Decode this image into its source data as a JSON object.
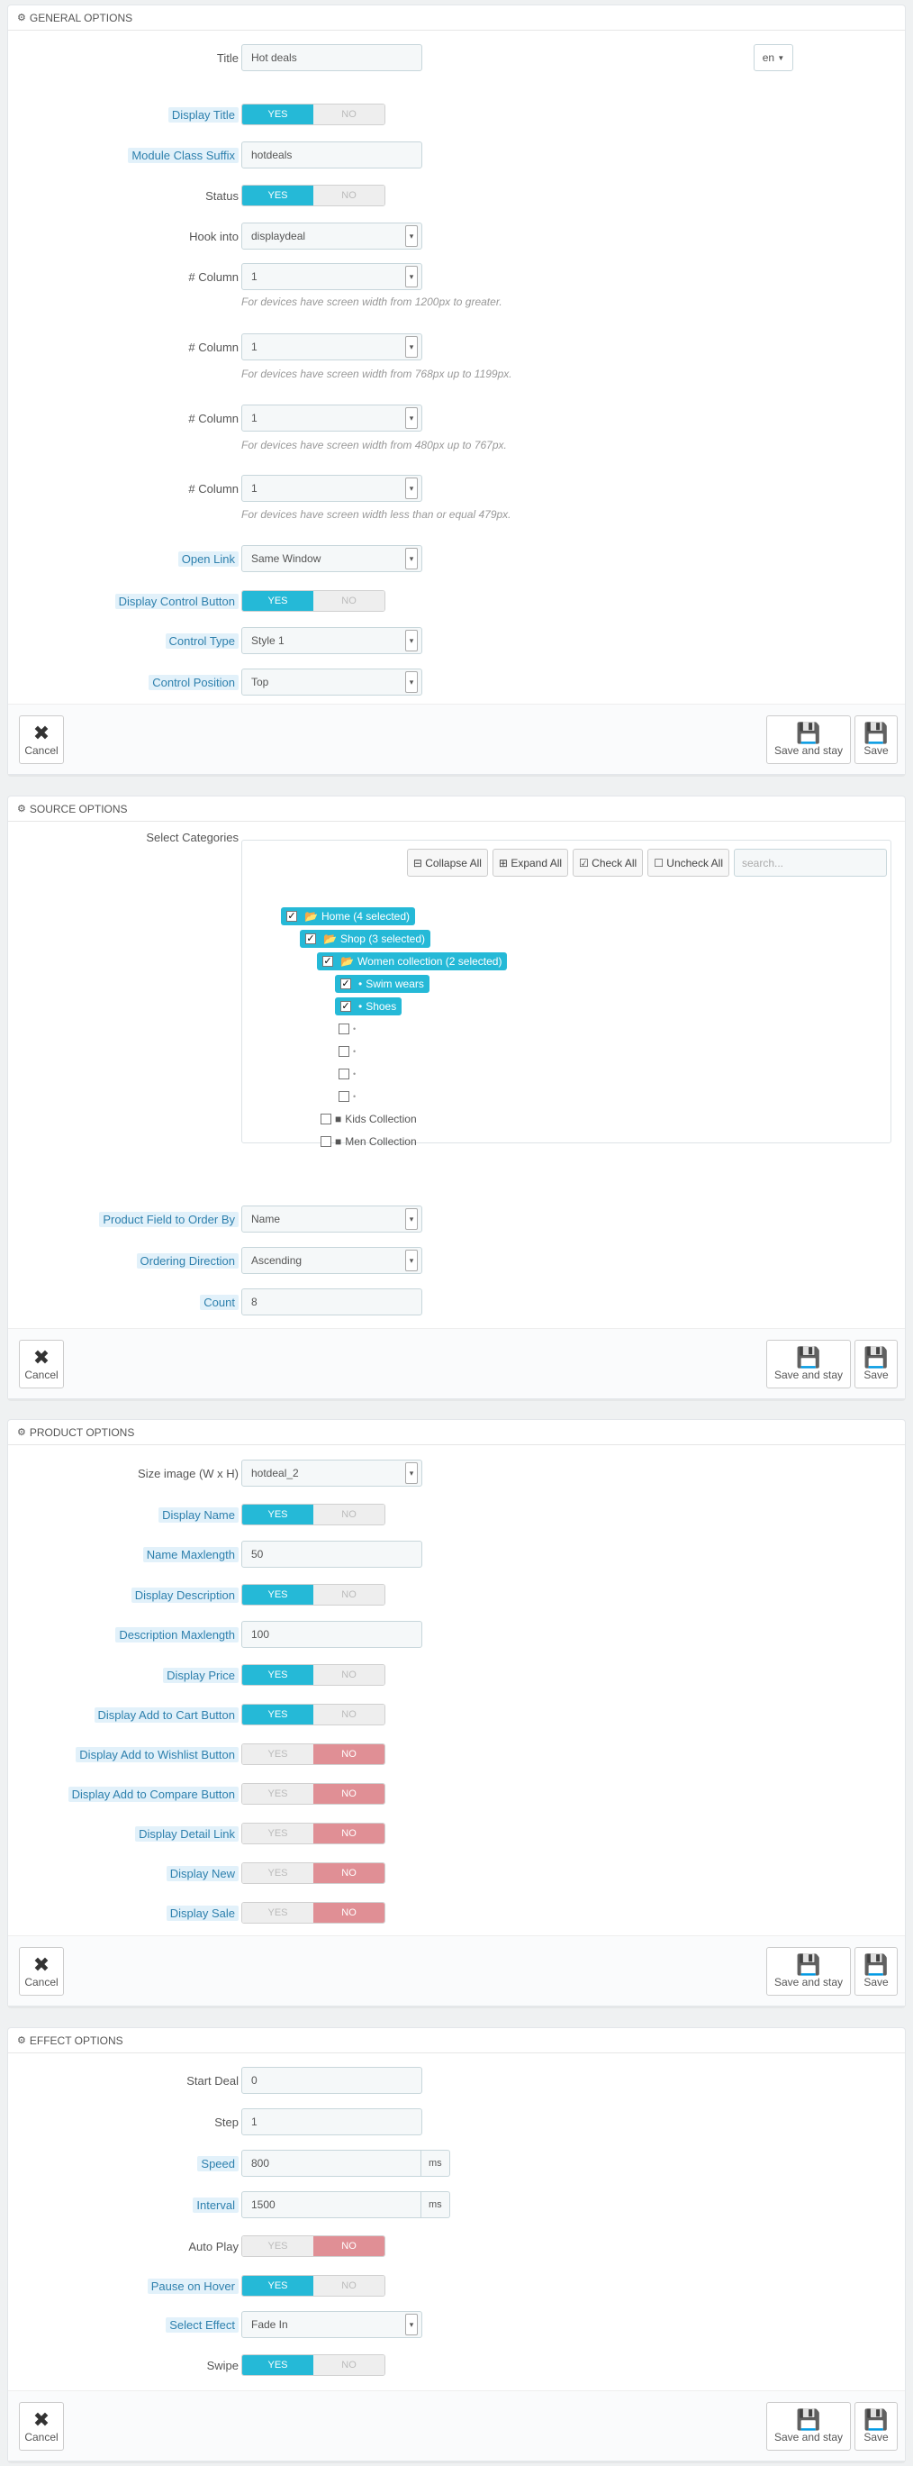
{
  "general": {
    "title": "GENERAL OPTIONS",
    "title_label": "Title",
    "title_value": "Hot deals",
    "lang": "en",
    "display_title_label": "Display Title",
    "class_suffix_label": "Module Class Suffix",
    "class_suffix_value": "hotdeals",
    "status_label": "Status",
    "hook_label": "Hook into",
    "hook_value": "displaydeal",
    "col_label": "# Column",
    "col_value": "1",
    "help_1200": "For devices have screen width from 1200px to greater.",
    "help_768": "For devices have screen width from 768px up to 1199px.",
    "help_480": "For devices have screen width from 480px up to 767px.",
    "help_479": "For devices have screen width less than or equal 479px.",
    "open_link_label": "Open Link",
    "open_link_value": "Same Window",
    "display_control_label": "Display Control Button",
    "control_type_label": "Control Type",
    "control_type_value": "Style 1",
    "control_position_label": "Control Position",
    "control_position_value": "Top"
  },
  "switch": {
    "yes": "YES",
    "no": "NO"
  },
  "footer": {
    "cancel": "Cancel",
    "save_stay": "Save and stay",
    "save": "Save"
  },
  "source": {
    "title": "SOURCE OPTIONS",
    "select_categories_label": "Select Categories",
    "collapse_all": "Collapse All",
    "expand_all": "Expand All",
    "check_all": "Check All",
    "uncheck_all": "Uncheck All",
    "search_placeholder": "search...",
    "tree": {
      "home": "Home (4 selected)",
      "shop": "Shop (3 selected)",
      "women": "Women collection (2 selected)",
      "swim": "Swim wears",
      "shoes": "Shoes",
      "kids": "Kids Collection",
      "men": "Men Collection"
    },
    "order_field_label": "Product Field to Order By",
    "order_field_value": "Name",
    "order_dir_label": "Ordering Direction",
    "order_dir_value": "Ascending",
    "count_label": "Count",
    "count_value": "8"
  },
  "product": {
    "title": "PRODUCT OPTIONS",
    "size_label": "Size image (W x H)",
    "size_value": "hotdeal_2",
    "display_name_label": "Display Name",
    "name_max_label": "Name Maxlength",
    "name_max_value": "50",
    "display_desc_label": "Display Description",
    "desc_max_label": "Description Maxlength",
    "desc_max_value": "100",
    "display_price_label": "Display Price",
    "add_cart_label": "Display Add to Cart Button",
    "wishlist_label": "Display Add to Wishlist Button",
    "compare_label": "Display Add to Compare Button",
    "detail_label": "Display Detail Link",
    "new_label": "Display New",
    "sale_label": "Display Sale"
  },
  "effect": {
    "title": "EFFECT OPTIONS",
    "start_label": "Start Deal",
    "start_value": "0",
    "step_label": "Step",
    "step_value": "1",
    "speed_label": "Speed",
    "speed_value": "800",
    "interval_label": "Interval",
    "interval_value": "1500",
    "ms": "ms",
    "autoplay_label": "Auto Play",
    "pause_label": "Pause on Hover",
    "select_effect_label": "Select Effect",
    "select_effect_value": "Fade In",
    "swipe_label": "Swipe"
  },
  "colors": {
    "accent": "#25b9d7",
    "no_active": "#e08f95",
    "hint_bg": "#e2f1fa"
  }
}
